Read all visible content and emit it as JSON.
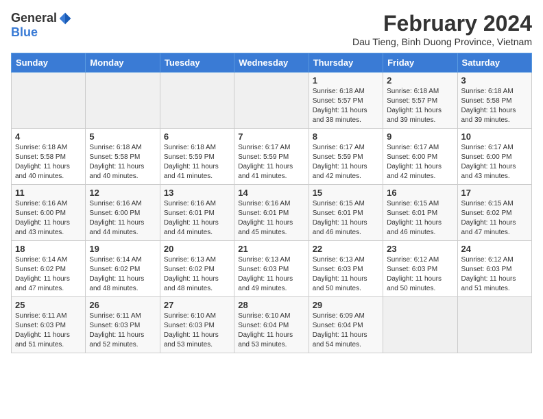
{
  "logo": {
    "general": "General",
    "blue": "Blue"
  },
  "title": {
    "month_year": "February 2024",
    "location": "Dau Tieng, Binh Duong Province, Vietnam"
  },
  "days_of_week": [
    "Sunday",
    "Monday",
    "Tuesday",
    "Wednesday",
    "Thursday",
    "Friday",
    "Saturday"
  ],
  "weeks": [
    [
      {
        "day": "",
        "info": ""
      },
      {
        "day": "",
        "info": ""
      },
      {
        "day": "",
        "info": ""
      },
      {
        "day": "",
        "info": ""
      },
      {
        "day": "1",
        "info": "Sunrise: 6:18 AM\nSunset: 5:57 PM\nDaylight: 11 hours and 38 minutes."
      },
      {
        "day": "2",
        "info": "Sunrise: 6:18 AM\nSunset: 5:57 PM\nDaylight: 11 hours and 39 minutes."
      },
      {
        "day": "3",
        "info": "Sunrise: 6:18 AM\nSunset: 5:58 PM\nDaylight: 11 hours and 39 minutes."
      }
    ],
    [
      {
        "day": "4",
        "info": "Sunrise: 6:18 AM\nSunset: 5:58 PM\nDaylight: 11 hours and 40 minutes."
      },
      {
        "day": "5",
        "info": "Sunrise: 6:18 AM\nSunset: 5:58 PM\nDaylight: 11 hours and 40 minutes."
      },
      {
        "day": "6",
        "info": "Sunrise: 6:18 AM\nSunset: 5:59 PM\nDaylight: 11 hours and 41 minutes."
      },
      {
        "day": "7",
        "info": "Sunrise: 6:17 AM\nSunset: 5:59 PM\nDaylight: 11 hours and 41 minutes."
      },
      {
        "day": "8",
        "info": "Sunrise: 6:17 AM\nSunset: 5:59 PM\nDaylight: 11 hours and 42 minutes."
      },
      {
        "day": "9",
        "info": "Sunrise: 6:17 AM\nSunset: 6:00 PM\nDaylight: 11 hours and 42 minutes."
      },
      {
        "day": "10",
        "info": "Sunrise: 6:17 AM\nSunset: 6:00 PM\nDaylight: 11 hours and 43 minutes."
      }
    ],
    [
      {
        "day": "11",
        "info": "Sunrise: 6:16 AM\nSunset: 6:00 PM\nDaylight: 11 hours and 43 minutes."
      },
      {
        "day": "12",
        "info": "Sunrise: 6:16 AM\nSunset: 6:00 PM\nDaylight: 11 hours and 44 minutes."
      },
      {
        "day": "13",
        "info": "Sunrise: 6:16 AM\nSunset: 6:01 PM\nDaylight: 11 hours and 44 minutes."
      },
      {
        "day": "14",
        "info": "Sunrise: 6:16 AM\nSunset: 6:01 PM\nDaylight: 11 hours and 45 minutes."
      },
      {
        "day": "15",
        "info": "Sunrise: 6:15 AM\nSunset: 6:01 PM\nDaylight: 11 hours and 46 minutes."
      },
      {
        "day": "16",
        "info": "Sunrise: 6:15 AM\nSunset: 6:01 PM\nDaylight: 11 hours and 46 minutes."
      },
      {
        "day": "17",
        "info": "Sunrise: 6:15 AM\nSunset: 6:02 PM\nDaylight: 11 hours and 47 minutes."
      }
    ],
    [
      {
        "day": "18",
        "info": "Sunrise: 6:14 AM\nSunset: 6:02 PM\nDaylight: 11 hours and 47 minutes."
      },
      {
        "day": "19",
        "info": "Sunrise: 6:14 AM\nSunset: 6:02 PM\nDaylight: 11 hours and 48 minutes."
      },
      {
        "day": "20",
        "info": "Sunrise: 6:13 AM\nSunset: 6:02 PM\nDaylight: 11 hours and 48 minutes."
      },
      {
        "day": "21",
        "info": "Sunrise: 6:13 AM\nSunset: 6:03 PM\nDaylight: 11 hours and 49 minutes."
      },
      {
        "day": "22",
        "info": "Sunrise: 6:13 AM\nSunset: 6:03 PM\nDaylight: 11 hours and 50 minutes."
      },
      {
        "day": "23",
        "info": "Sunrise: 6:12 AM\nSunset: 6:03 PM\nDaylight: 11 hours and 50 minutes."
      },
      {
        "day": "24",
        "info": "Sunrise: 6:12 AM\nSunset: 6:03 PM\nDaylight: 11 hours and 51 minutes."
      }
    ],
    [
      {
        "day": "25",
        "info": "Sunrise: 6:11 AM\nSunset: 6:03 PM\nDaylight: 11 hours and 51 minutes."
      },
      {
        "day": "26",
        "info": "Sunrise: 6:11 AM\nSunset: 6:03 PM\nDaylight: 11 hours and 52 minutes."
      },
      {
        "day": "27",
        "info": "Sunrise: 6:10 AM\nSunset: 6:03 PM\nDaylight: 11 hours and 53 minutes."
      },
      {
        "day": "28",
        "info": "Sunrise: 6:10 AM\nSunset: 6:04 PM\nDaylight: 11 hours and 53 minutes."
      },
      {
        "day": "29",
        "info": "Sunrise: 6:09 AM\nSunset: 6:04 PM\nDaylight: 11 hours and 54 minutes."
      },
      {
        "day": "",
        "info": ""
      },
      {
        "day": "",
        "info": ""
      }
    ]
  ]
}
